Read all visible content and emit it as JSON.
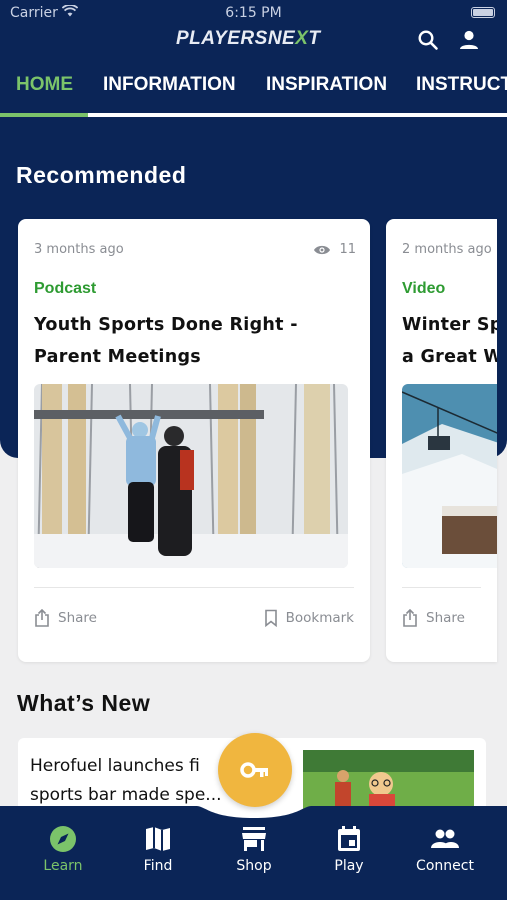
{
  "status_bar": {
    "carrier": "Carrier",
    "time": "6:15 PM"
  },
  "header": {
    "logo_main": "PLAYERSNE",
    "logo_accent": "X",
    "logo_tail": "T",
    "icons": [
      "search-icon",
      "user-icon"
    ]
  },
  "tabs": [
    {
      "label": "HOME",
      "active": true
    },
    {
      "label": "INFORMATION",
      "active": false
    },
    {
      "label": "INSPIRATION",
      "active": false
    },
    {
      "label": "INSTRUCT",
      "active": false
    }
  ],
  "recommended": {
    "title": "Recommended",
    "cards": [
      {
        "ago": "3 months ago",
        "views": "11",
        "category": "Podcast",
        "title": "Youth Sports Done Right -\nParent Meetings",
        "share_label": "Share",
        "bookmark_label": "Bookmark"
      },
      {
        "ago": "2 months ago",
        "category": "Video",
        "title": "Winter Sp\na Great W",
        "share_label": "Share"
      }
    ]
  },
  "whats_new": {
    "title": "What’s New",
    "headline": "Herofuel launches fi\nsports bar made spe..."
  },
  "fab": {
    "icon": "key-icon"
  },
  "bottom_nav": [
    {
      "label": "Learn",
      "icon": "compass-icon",
      "active": true
    },
    {
      "label": "Find",
      "icon": "map-icon",
      "active": false
    },
    {
      "label": "Shop",
      "icon": "store-icon",
      "active": false
    },
    {
      "label": "Play",
      "icon": "calendar-icon",
      "active": false
    },
    {
      "label": "Connect",
      "icon": "people-icon",
      "active": false
    }
  ],
  "colors": {
    "navy": "#0b2557",
    "green": "#7bc36a",
    "category_green": "#2e9b32",
    "fab": "#f0b63f",
    "background": "#efeff0"
  }
}
